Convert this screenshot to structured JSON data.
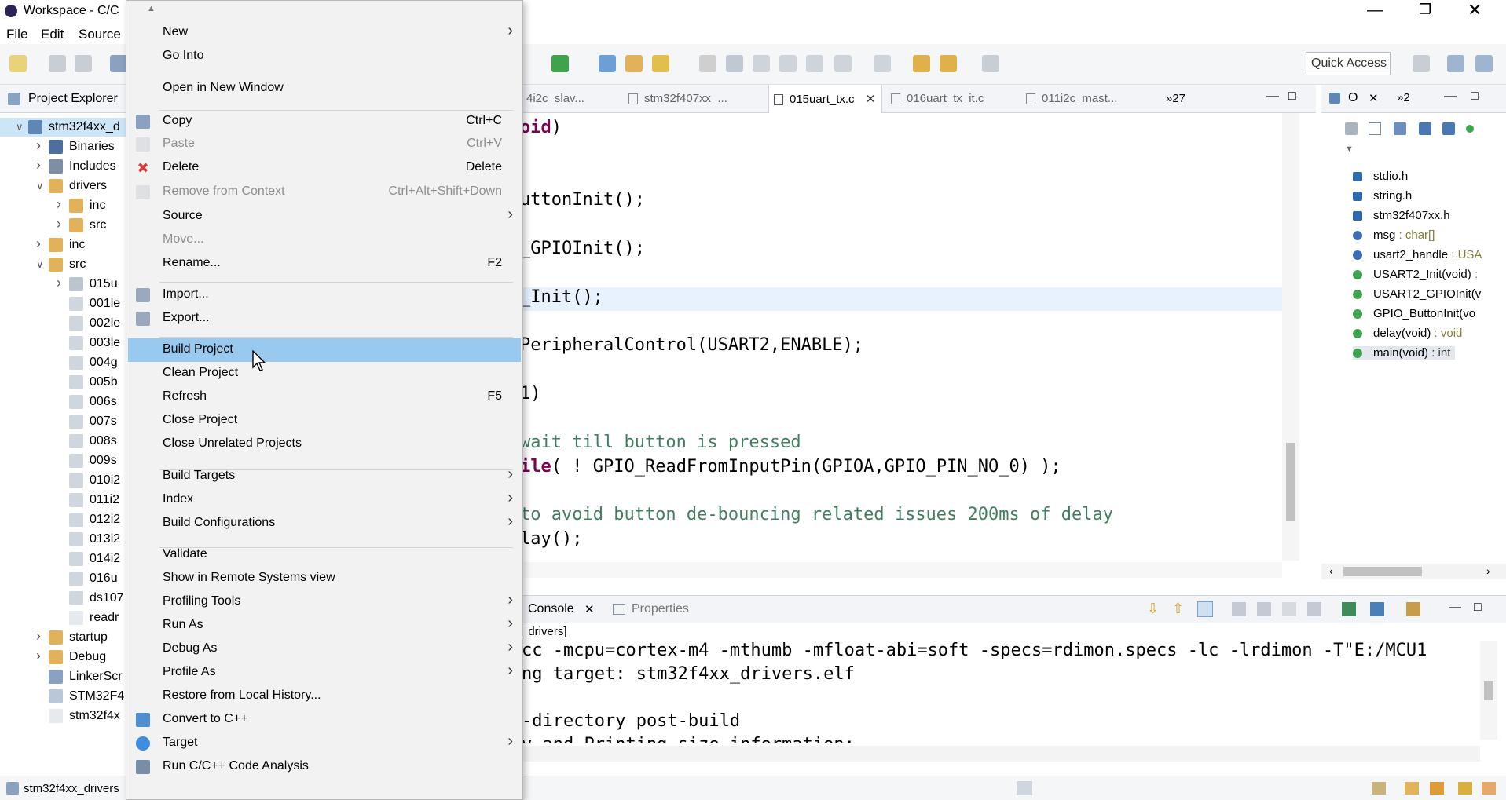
{
  "window": {
    "title": "Workspace - C/C"
  },
  "menubar": [
    "File",
    "Edit",
    "Source"
  ],
  "toolbar": {
    "quick_access": "Quick Access"
  },
  "explorer": {
    "title": "Project Explorer",
    "items": [
      {
        "label": "stm32f4xx_d"
      },
      {
        "label": "Binaries"
      },
      {
        "label": "Includes"
      },
      {
        "label": "drivers"
      },
      {
        "label": "inc"
      },
      {
        "label": "src"
      },
      {
        "label": "inc"
      },
      {
        "label": "src"
      },
      {
        "label": "015u"
      },
      {
        "label": "001le"
      },
      {
        "label": "002le"
      },
      {
        "label": "003le"
      },
      {
        "label": "004g"
      },
      {
        "label": "005b"
      },
      {
        "label": "006s"
      },
      {
        "label": "007s"
      },
      {
        "label": "008s"
      },
      {
        "label": "009s"
      },
      {
        "label": "010i2"
      },
      {
        "label": "011i2"
      },
      {
        "label": "012i2"
      },
      {
        "label": "013i2"
      },
      {
        "label": "014i2"
      },
      {
        "label": "016u"
      },
      {
        "label": "ds107"
      },
      {
        "label": "readr"
      },
      {
        "label": "startup"
      },
      {
        "label": "Debug"
      },
      {
        "label": "LinkerScr"
      },
      {
        "label": "STM32F4"
      },
      {
        "label": "stm32f4x"
      }
    ]
  },
  "editor": {
    "tabs": [
      "4i2c_slav...",
      "stm32f407xx_...",
      "015uart_tx.c",
      "016uart_tx_it.c",
      "011i2c_mast..."
    ],
    "overflow": "»27",
    "code_lines": [
      {
        "pre": "",
        "kw": "oid",
        "post": ")"
      },
      {
        "pre": "uttonInit();",
        "kw": "",
        "post": ""
      },
      {
        "pre": "_GPIOInit();",
        "kw": "",
        "post": ""
      },
      {
        "pre": "_Init();",
        "kw": "",
        "post": ""
      },
      {
        "pre": "PeripheralControl(USART2,ENABLE);",
        "kw": "",
        "post": ""
      },
      {
        "pre": "1)",
        "kw": "",
        "post": ""
      },
      {
        "pre": "",
        "kw": "",
        "post": "",
        "comment": "wait till button is pressed"
      },
      {
        "pre": "",
        "kw": "ile",
        "post": "( ! GPIO_ReadFromInputPin(GPIOA,GPIO_PIN_NO_0) );"
      },
      {
        "pre": "",
        "kw": "",
        "post": "",
        "comment": "to avoid button de-bouncing related issues 200ms of delay"
      },
      {
        "pre": "lay();",
        "kw": "",
        "post": ""
      }
    ]
  },
  "outline": {
    "tabs": [
      "O",
      "»2"
    ],
    "items": [
      {
        "label": "stdio.h",
        "type": ""
      },
      {
        "label": "string.h",
        "type": ""
      },
      {
        "label": "stm32f407xx.h",
        "type": ""
      },
      {
        "label": "msg",
        "type": " : char[]"
      },
      {
        "label": "usart2_handle",
        "type": " : USA"
      },
      {
        "label": "USART2_Init(void)",
        "type": " :"
      },
      {
        "label": "USART2_GPIOInit(v",
        "type": ""
      },
      {
        "label": "GPIO_ButtonInit(vo",
        "type": ""
      },
      {
        "label": "delay(void)",
        "type": " : void"
      },
      {
        "label": "main(void)",
        "type": " : int"
      }
    ]
  },
  "console": {
    "tabs": [
      "Console",
      "Properties"
    ],
    "header": "_drivers]",
    "lines": [
      "cc -mcpu=cortex-m4 -mthumb -mfloat-abi=soft -specs=rdimon.specs -lc -lrdimon -T\"E:/MCU1",
      "ng target: stm32f4xx_drivers.elf",
      "",
      "-directory post-build",
      "v and Printing size information:"
    ]
  },
  "statusbar": {
    "selected": "stm32f4xx_drivers"
  },
  "context_menu": {
    "items": [
      {
        "label": "New",
        "shortcut": "",
        "submenu": true,
        "disabled": false
      },
      {
        "label": "Go Into",
        "shortcut": "",
        "submenu": false,
        "disabled": false
      },
      {
        "label": "Open in New Window",
        "shortcut": "",
        "submenu": false,
        "disabled": false
      },
      {
        "label": "Copy",
        "shortcut": "Ctrl+C",
        "submenu": false,
        "disabled": false,
        "icon": "copy-icon"
      },
      {
        "label": "Paste",
        "shortcut": "Ctrl+V",
        "submenu": false,
        "disabled": true,
        "icon": "paste-icon"
      },
      {
        "label": "Delete",
        "shortcut": "Delete",
        "submenu": false,
        "disabled": false,
        "icon": "delete-icon"
      },
      {
        "label": "Remove from Context",
        "shortcut": "Ctrl+Alt+Shift+Down",
        "submenu": false,
        "disabled": true,
        "icon": "remove-context-icon"
      },
      {
        "label": "Source",
        "shortcut": "",
        "submenu": true,
        "disabled": false
      },
      {
        "label": "Move...",
        "shortcut": "",
        "submenu": false,
        "disabled": true
      },
      {
        "label": "Rename...",
        "shortcut": "F2",
        "submenu": false,
        "disabled": false
      },
      {
        "label": "Import...",
        "shortcut": "",
        "submenu": false,
        "disabled": false,
        "icon": "import-icon"
      },
      {
        "label": "Export...",
        "shortcut": "",
        "submenu": false,
        "disabled": false,
        "icon": "export-icon"
      },
      {
        "label": "Build Project",
        "shortcut": "",
        "submenu": false,
        "disabled": false,
        "highlighted": true
      },
      {
        "label": "Clean Project",
        "shortcut": "",
        "submenu": false,
        "disabled": false
      },
      {
        "label": "Refresh",
        "shortcut": "F5",
        "submenu": false,
        "disabled": false
      },
      {
        "label": "Close Project",
        "shortcut": "",
        "submenu": false,
        "disabled": false
      },
      {
        "label": "Close Unrelated Projects",
        "shortcut": "",
        "submenu": false,
        "disabled": false
      },
      {
        "label": "Build Targets",
        "shortcut": "",
        "submenu": true,
        "disabled": false
      },
      {
        "label": "Index",
        "shortcut": "",
        "submenu": true,
        "disabled": false
      },
      {
        "label": "Build Configurations",
        "shortcut": "",
        "submenu": true,
        "disabled": false
      },
      {
        "label": "Validate",
        "shortcut": "",
        "submenu": false,
        "disabled": false
      },
      {
        "label": "Show in Remote Systems view",
        "shortcut": "",
        "submenu": false,
        "disabled": false
      },
      {
        "label": "Profiling Tools",
        "shortcut": "",
        "submenu": true,
        "disabled": false
      },
      {
        "label": "Run As",
        "shortcut": "",
        "submenu": true,
        "disabled": false
      },
      {
        "label": "Debug As",
        "shortcut": "",
        "submenu": true,
        "disabled": false
      },
      {
        "label": "Profile As",
        "shortcut": "",
        "submenu": true,
        "disabled": false
      },
      {
        "label": "Restore from Local History...",
        "shortcut": "",
        "submenu": false,
        "disabled": false
      },
      {
        "label": "Convert to C++",
        "shortcut": "",
        "submenu": false,
        "disabled": false,
        "icon": "convert-icon"
      },
      {
        "label": "Target",
        "shortcut": "",
        "submenu": true,
        "disabled": false,
        "icon": "target-icon"
      },
      {
        "label": "Run C/C++ Code Analysis",
        "shortcut": "",
        "submenu": false,
        "disabled": false,
        "icon": "code-analysis-icon"
      }
    ]
  },
  "colors": {
    "highlight": "#99c9ef",
    "keyword": "#7f0055",
    "comment": "#3f7f5f",
    "menu_bg": "#f2f2f2"
  }
}
